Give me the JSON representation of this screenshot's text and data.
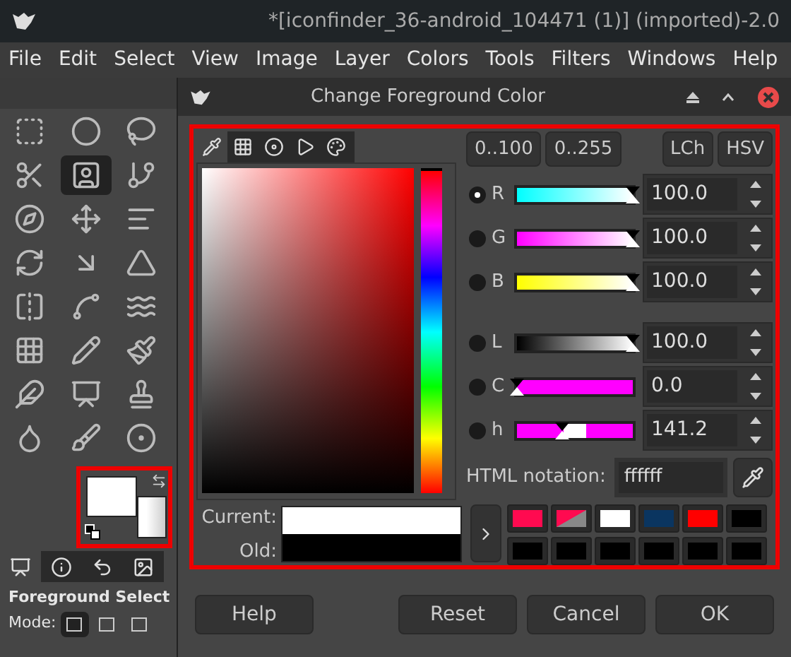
{
  "window": {
    "title": "*[iconfinder_36-android_104471 (1)] (imported)-2.0"
  },
  "menu": [
    "File",
    "Edit",
    "Select",
    "View",
    "Image",
    "Layer",
    "Colors",
    "Tools",
    "Filters",
    "Windows",
    "Help"
  ],
  "tools": [
    {
      "selected": false
    },
    {
      "selected": false
    },
    {
      "selected": false
    },
    {
      "selected": false
    },
    {
      "selected": true
    },
    {
      "selected": false
    },
    {
      "selected": false
    },
    {
      "selected": false
    },
    {
      "selected": false
    },
    {
      "selected": false
    },
    {
      "selected": false
    },
    {
      "selected": false
    },
    {
      "selected": false
    },
    {
      "selected": false
    },
    {
      "selected": false
    },
    {
      "selected": false
    },
    {
      "selected": false
    },
    {
      "selected": false
    },
    {
      "selected": false
    },
    {
      "selected": false
    },
    {
      "selected": false
    },
    {
      "selected": false
    },
    {
      "selected": false
    },
    {
      "selected": false
    }
  ],
  "dock_tabs": [
    {
      "selected": true
    },
    {
      "selected": false
    },
    {
      "selected": false
    },
    {
      "selected": false
    }
  ],
  "tool_options": {
    "title": "Foreground Select",
    "mode_label": "Mode:",
    "modes": [
      {
        "selected": true
      },
      {
        "selected": false
      },
      {
        "selected": false
      }
    ]
  },
  "dialog": {
    "title": "Change Foreground Color",
    "selector_tabs": [
      {
        "selected": true
      },
      {
        "selected": false
      },
      {
        "selected": false
      },
      {
        "selected": false
      },
      {
        "selected": false
      }
    ],
    "range_buttons": [
      "0..100",
      "0..255"
    ],
    "model_buttons": [
      "LCh",
      "HSV"
    ],
    "channels": [
      {
        "label": "R",
        "selected": true,
        "level": 1,
        "value": "100.0"
      },
      {
        "label": "G",
        "selected": false,
        "level": 1,
        "value": "100.0"
      },
      {
        "label": "B",
        "selected": false,
        "level": 1,
        "value": "100.0"
      },
      {
        "label": "L",
        "selected": false,
        "level": 1,
        "value": "100.0"
      },
      {
        "label": "C",
        "selected": false,
        "level": 0,
        "value": "0.0"
      },
      {
        "label": "h",
        "selected": false,
        "level": 0.39,
        "value": "141.2"
      }
    ],
    "html_label": "HTML notation:",
    "html_value": "ffffff",
    "current_label": "Current:",
    "old_label": "Old:",
    "history": [
      {
        "color": "#ff0a50",
        "kind": "solid"
      },
      {
        "color": "#ff0a50",
        "kind": "partial"
      },
      {
        "color": "#ffffff",
        "kind": "solid"
      },
      {
        "color": "#0a3560",
        "kind": "solid"
      },
      {
        "color": "#ff0000",
        "kind": "solid"
      },
      {
        "color": "#000000",
        "kind": "solid"
      },
      {
        "color": "#000000",
        "kind": "solid"
      },
      {
        "color": "#000000",
        "kind": "solid"
      },
      {
        "color": "#000000",
        "kind": "solid"
      },
      {
        "color": "#000000",
        "kind": "solid"
      },
      {
        "color": "#000000",
        "kind": "solid"
      },
      {
        "color": "#000000",
        "kind": "solid"
      }
    ],
    "buttons": [
      "Help",
      "Reset",
      "Cancel",
      "OK"
    ]
  }
}
